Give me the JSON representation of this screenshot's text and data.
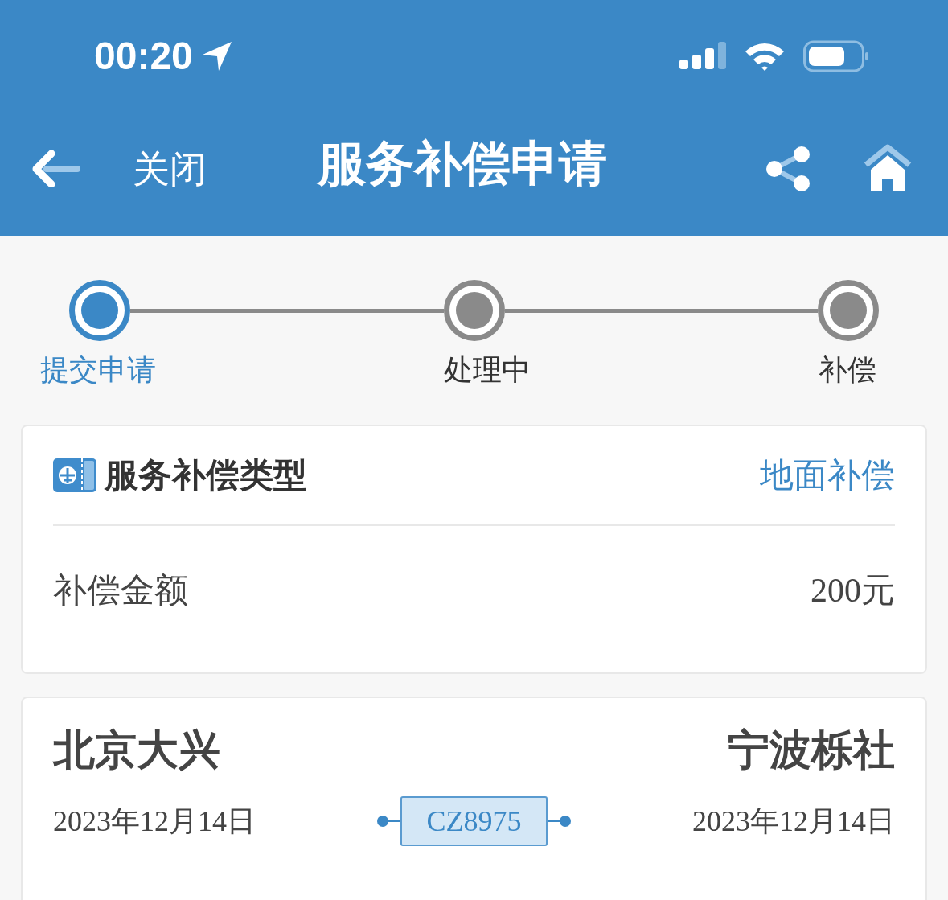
{
  "status_bar": {
    "time": "00:20"
  },
  "nav": {
    "close": "关闭",
    "title": "服务补偿申请"
  },
  "steps": [
    {
      "label": "提交申请",
      "selected": true
    },
    {
      "label": "处理中",
      "selected": false
    },
    {
      "label": "补偿",
      "selected": false
    }
  ],
  "compensation": {
    "type_label": "服务补偿类型",
    "type_value": "地面补偿",
    "amount_label": "补偿金额",
    "amount_value": "200元"
  },
  "flight": {
    "from": "北京大兴",
    "to": "宁波栎社",
    "depart_date": "2023年12月14日",
    "arrive_date": "2023年12月14日",
    "number": "CZ8975"
  }
}
